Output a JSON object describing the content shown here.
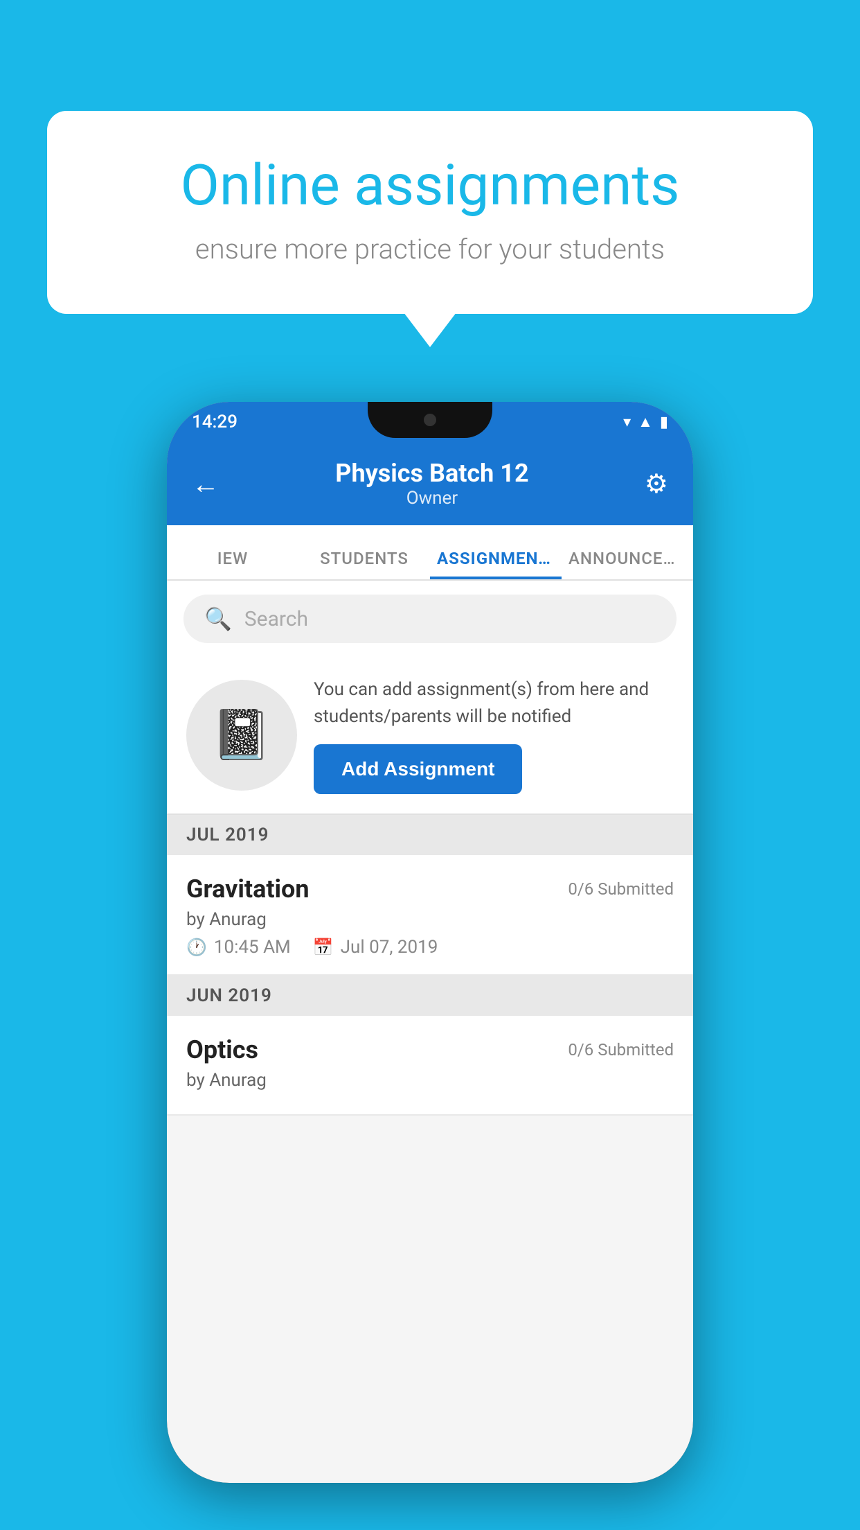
{
  "background_color": "#1ab8e8",
  "speech_bubble": {
    "title": "Online assignments",
    "subtitle": "ensure more practice for your students"
  },
  "status_bar": {
    "time": "14:29",
    "icons": [
      "wifi",
      "signal",
      "battery"
    ]
  },
  "header": {
    "title": "Physics Batch 12",
    "subtitle": "Owner",
    "back_label": "←",
    "gear_label": "⚙"
  },
  "tabs": [
    {
      "label": "IEW",
      "active": false
    },
    {
      "label": "STUDENTS",
      "active": false
    },
    {
      "label": "ASSIGNMENTS",
      "active": true
    },
    {
      "label": "ANNOUNCEM…",
      "active": false
    }
  ],
  "search": {
    "placeholder": "Search"
  },
  "promo": {
    "description": "You can add assignment(s) from here and students/parents will be notified",
    "button_label": "Add Assignment"
  },
  "sections": [
    {
      "header": "JUL 2019",
      "assignments": [
        {
          "title": "Gravitation",
          "submitted": "0/6 Submitted",
          "by": "by Anurag",
          "time": "10:45 AM",
          "date": "Jul 07, 2019"
        }
      ]
    },
    {
      "header": "JUN 2019",
      "assignments": [
        {
          "title": "Optics",
          "submitted": "0/6 Submitted",
          "by": "by Anurag",
          "time": "",
          "date": ""
        }
      ]
    }
  ]
}
